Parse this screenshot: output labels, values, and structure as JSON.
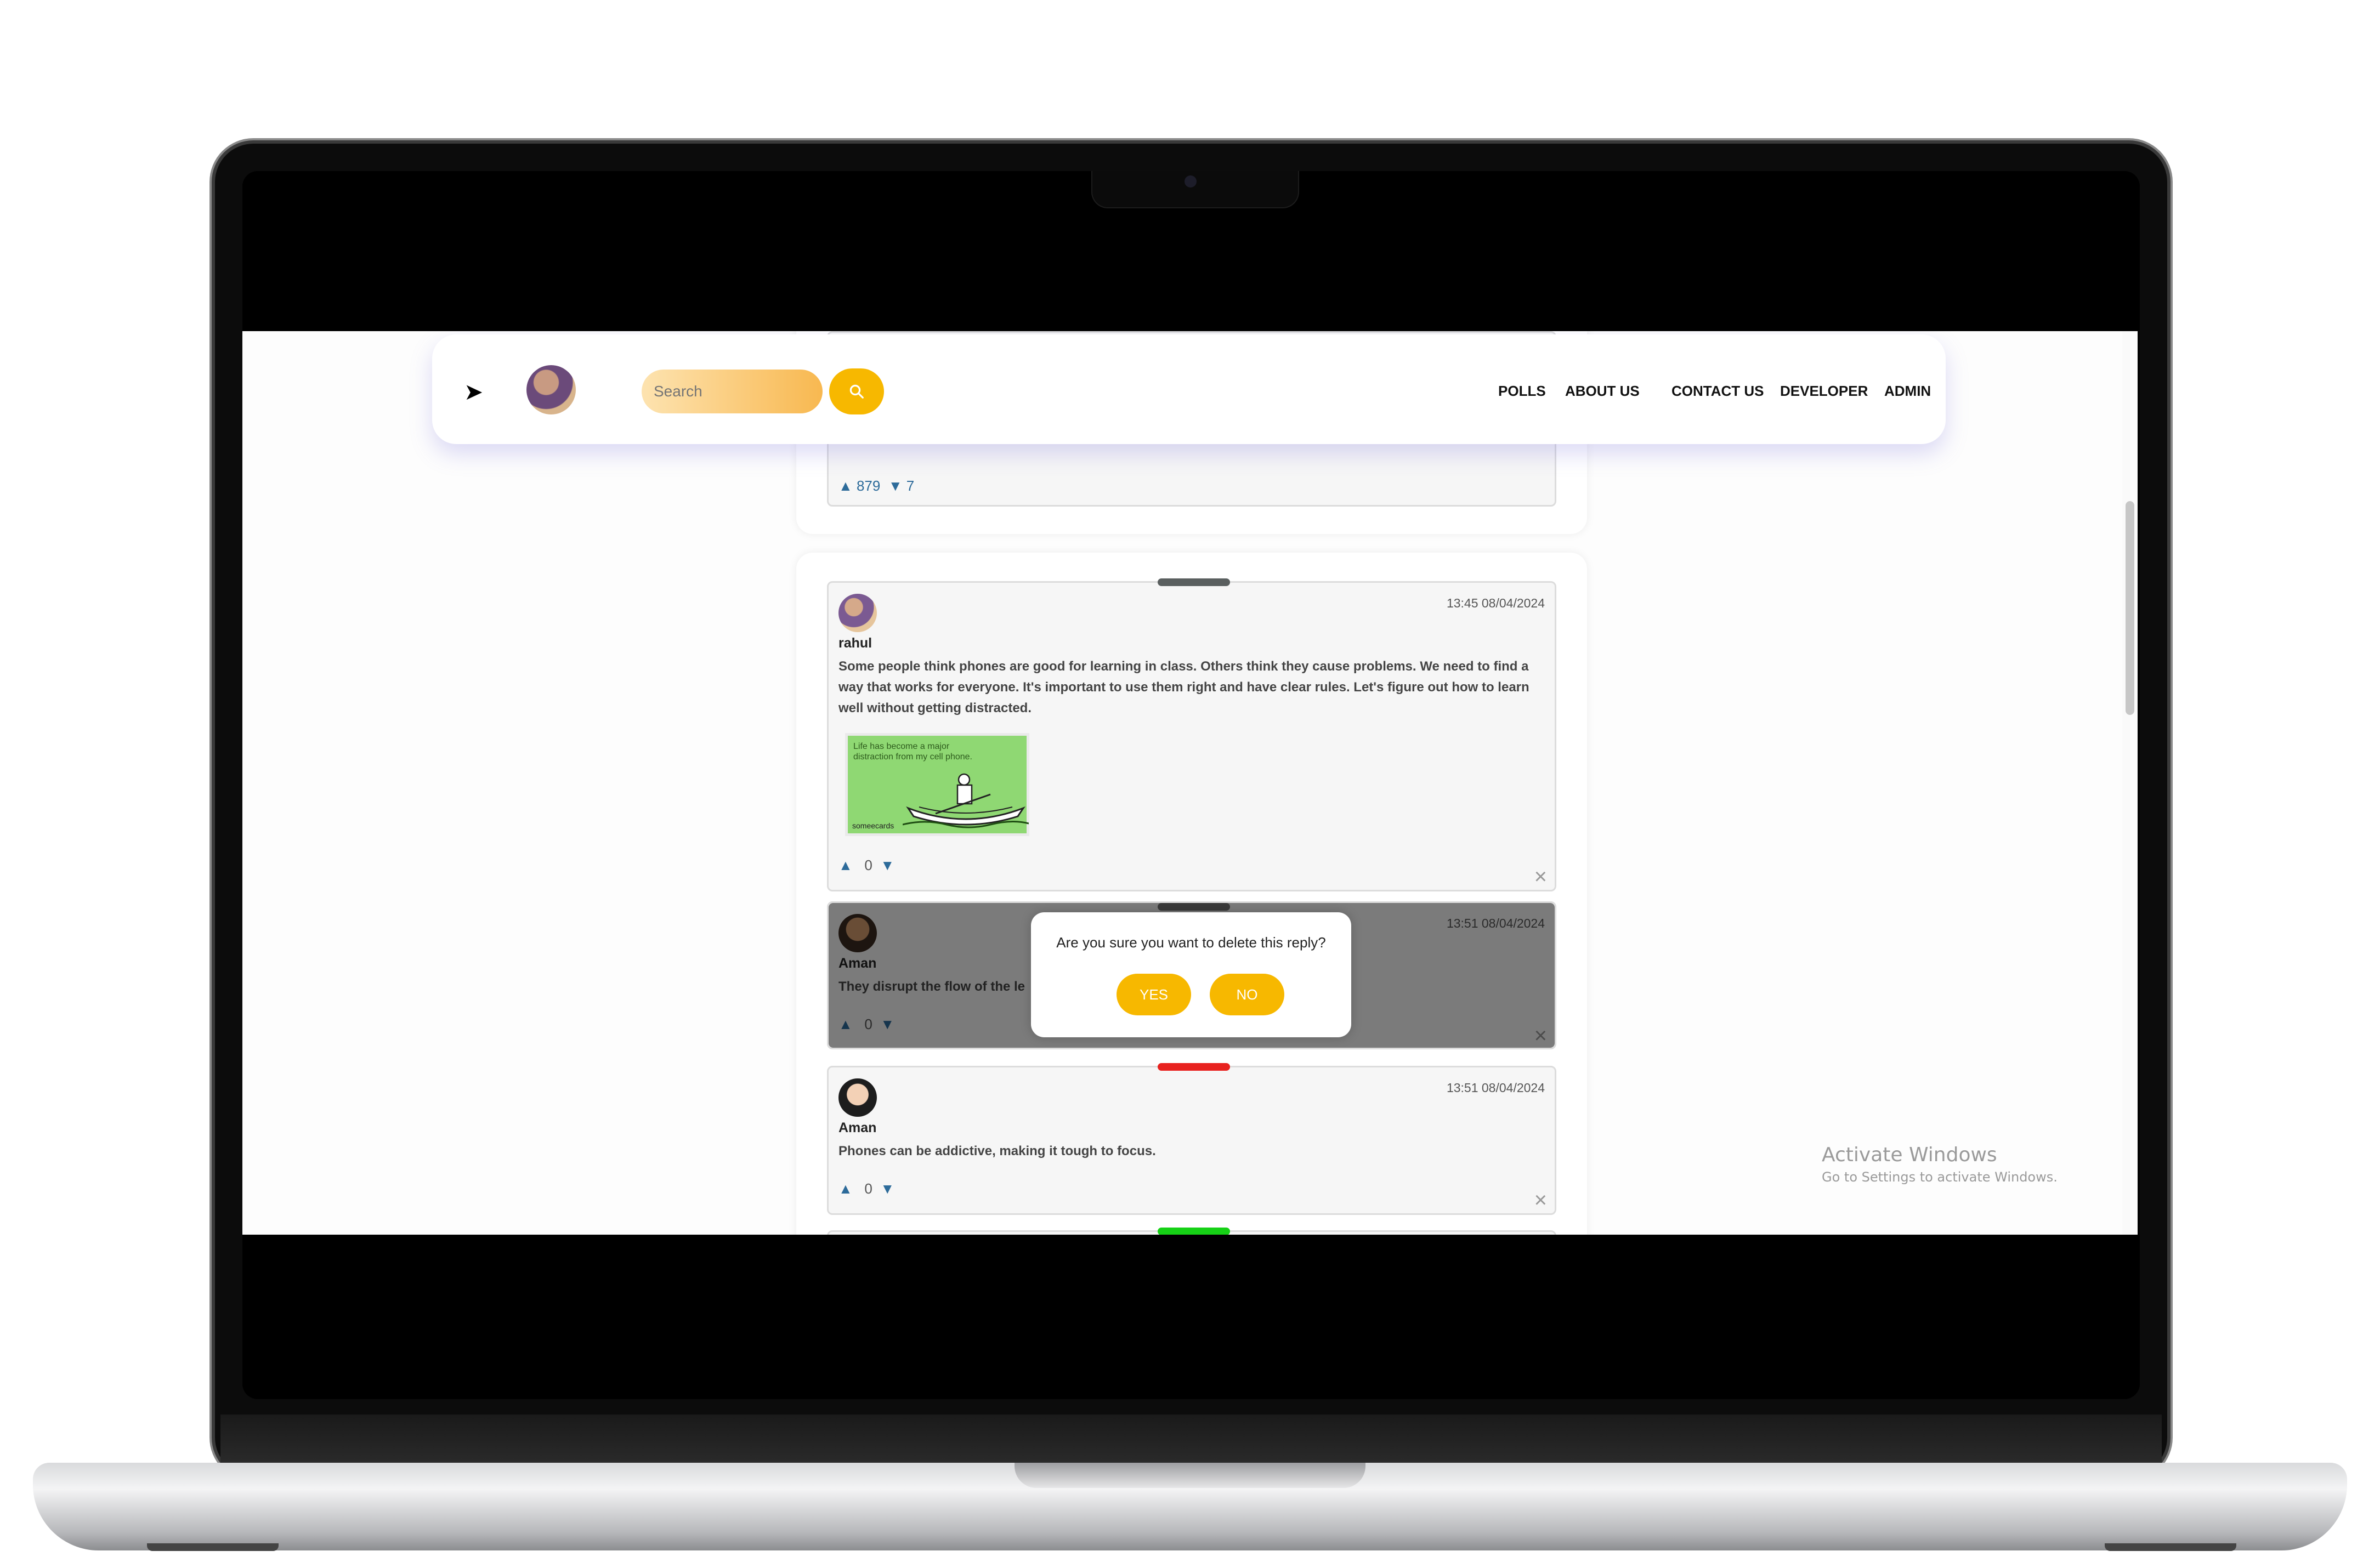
{
  "navbar": {
    "search_placeholder": "Search",
    "links": [
      "POLLS",
      "ABOUT US",
      "CONTACT US",
      "DEVELOPER",
      "ADMIN"
    ]
  },
  "previous_post": {
    "up_votes": "879",
    "down_votes": "7"
  },
  "thread": {
    "main": {
      "user": "rahul",
      "time": "13:45 08/04/2024",
      "text": "Some people think phones are good for learning in class. Others think they cause problems. We need to find a way that works for everyone. It's important to use them right and have clear rules. Let's figure out how to learn well without getting distracted.",
      "image_caption": "Life has become a major distraction from my cell phone.",
      "image_brand": "someecards",
      "votes": "0"
    },
    "replies": [
      {
        "user": "Aman",
        "time": "13:51 08/04/2024",
        "text": "They disrupt the flow of the le",
        "votes": "0",
        "grip_color": "#333333"
      },
      {
        "user": "Aman",
        "time": "13:51 08/04/2024",
        "text": "Phones can be addictive, making it tough to focus.",
        "votes": "0",
        "grip_color": "#e8221f"
      }
    ],
    "next_grip_color": "#16d116"
  },
  "modal": {
    "message": "Are you sure you want to delete this reply?",
    "yes": "YES",
    "no": "NO"
  },
  "watermark": {
    "title": "Activate Windows",
    "subtitle": "Go to Settings to activate Windows."
  }
}
